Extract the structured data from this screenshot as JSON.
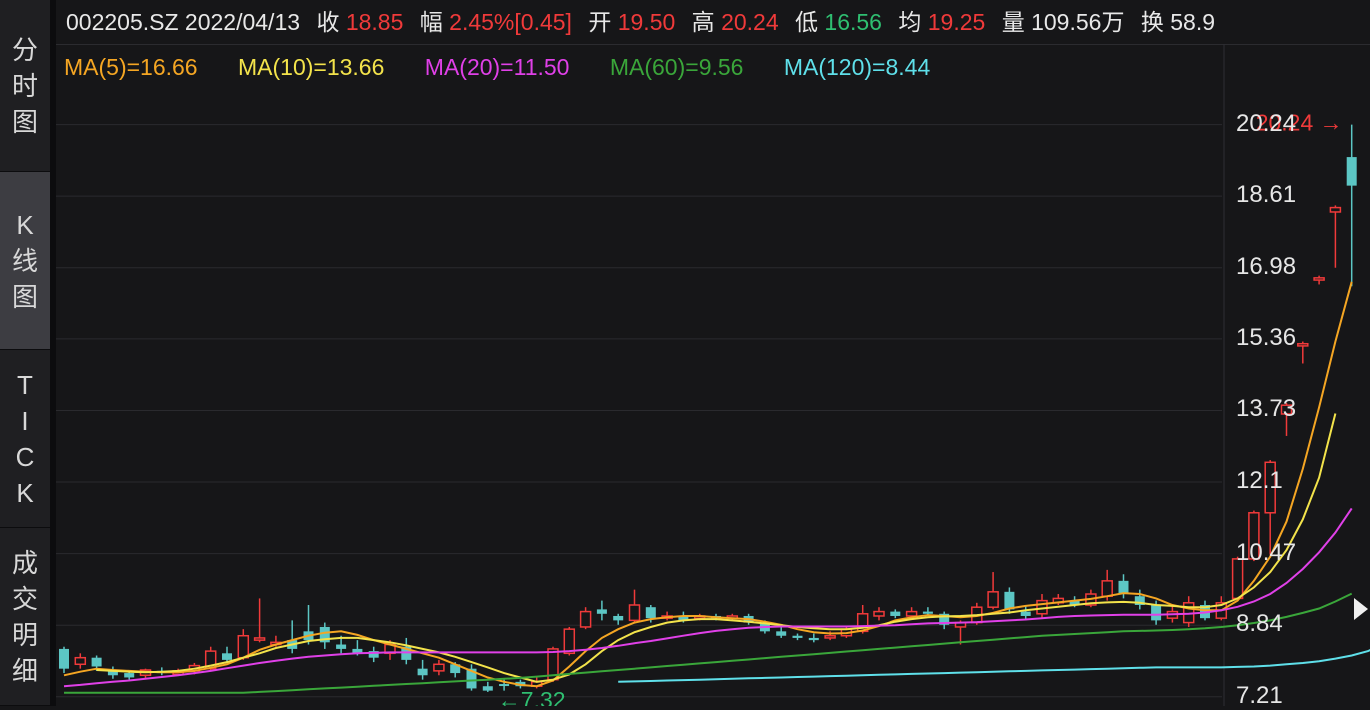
{
  "sidebar": {
    "tabs": [
      {
        "label": "分时图",
        "chars": [
          "分",
          "时",
          "图"
        ],
        "active": false
      },
      {
        "label": "K线图",
        "chars": [
          "K",
          "线",
          "图"
        ],
        "active": true
      },
      {
        "label": "TICK",
        "chars": [
          "T",
          "I",
          "C",
          "K"
        ],
        "active": false
      },
      {
        "label": "成交明细",
        "chars": [
          "成",
          "交",
          "明",
          "细"
        ],
        "active": false
      }
    ]
  },
  "header": {
    "code_date": "002205.SZ 2022/04/13",
    "close_label": "收",
    "close_value": "18.85",
    "change_label": "幅",
    "change_value": "2.45%[0.45]",
    "open_label": "开",
    "open_value": "19.50",
    "high_label": "高",
    "high_value": "20.24",
    "low_label": "低",
    "low_value": "16.56",
    "avg_label": "均",
    "avg_value": "19.25",
    "volume_label": "量",
    "volume_value": "109.56万",
    "turnover_label": "换",
    "turnover_value": "58.9"
  },
  "ma_legend": [
    {
      "text": "MA(5)=16.66",
      "color": "#f5a623"
    },
    {
      "text": "MA(10)=13.66",
      "color": "#f3e34b"
    },
    {
      "text": "MA(20)=11.50",
      "color": "#e040e8"
    },
    {
      "text": "MA(60)=9.56",
      "color": "#3aa63a"
    },
    {
      "text": "MA(120)=8.44",
      "color": "#5fe0ea"
    }
  ],
  "chart_data": {
    "type": "candlestick",
    "ylim": [
      7.0,
      20.8
    ],
    "yticks": [
      "20.24",
      "18.61",
      "16.98",
      "15.36",
      "13.73",
      "12.1",
      "10.47",
      "8.84",
      "7.21"
    ],
    "up_color": "#f03a3a",
    "down_color": "#5cc6c4",
    "max_annotation": {
      "text": "20.24",
      "value": 20.24,
      "arrow": "→"
    },
    "min_annotation": {
      "text": "7.32",
      "value": 7.32,
      "arrow": "←"
    },
    "candles": [
      [
        8.3,
        7.85,
        8.35,
        7.75
      ],
      [
        7.95,
        8.1,
        8.2,
        7.85
      ],
      [
        8.1,
        7.9,
        8.15,
        7.8
      ],
      [
        7.8,
        7.7,
        7.9,
        7.62
      ],
      [
        7.75,
        7.65,
        7.8,
        7.6
      ],
      [
        7.7,
        7.82,
        7.85,
        7.62
      ],
      [
        7.8,
        7.75,
        7.88,
        7.7
      ],
      [
        7.72,
        7.8,
        7.85,
        7.7
      ],
      [
        7.8,
        7.92,
        7.98,
        7.72
      ],
      [
        7.85,
        8.25,
        8.35,
        7.8
      ],
      [
        8.2,
        8.05,
        8.35,
        8.0
      ],
      [
        8.1,
        8.6,
        8.75,
        8.05
      ],
      [
        8.5,
        8.55,
        9.45,
        8.45
      ],
      [
        8.4,
        8.45,
        8.6,
        8.35
      ],
      [
        8.5,
        8.3,
        8.95,
        8.2
      ],
      [
        8.7,
        8.5,
        9.3,
        8.4
      ],
      [
        8.8,
        8.45,
        8.9,
        8.3
      ],
      [
        8.4,
        8.3,
        8.6,
        8.2
      ],
      [
        8.3,
        8.2,
        8.5,
        8.15
      ],
      [
        8.25,
        8.1,
        8.35,
        8.0
      ],
      [
        8.2,
        8.4,
        8.5,
        8.05
      ],
      [
        8.35,
        8.05,
        8.55,
        7.95
      ],
      [
        7.85,
        7.7,
        8.05,
        7.6
      ],
      [
        7.8,
        7.95,
        8.05,
        7.7
      ],
      [
        7.95,
        7.75,
        8.0,
        7.65
      ],
      [
        7.85,
        7.4,
        7.95,
        7.35
      ],
      [
        7.45,
        7.35,
        7.55,
        7.32
      ],
      [
        7.5,
        7.48,
        7.6,
        7.35
      ],
      [
        7.55,
        7.45,
        7.6,
        7.4
      ],
      [
        7.45,
        7.55,
        7.65,
        7.4
      ],
      [
        7.6,
        8.3,
        8.35,
        7.55
      ],
      [
        8.2,
        8.75,
        8.8,
        8.15
      ],
      [
        8.8,
        9.15,
        9.25,
        8.75
      ],
      [
        9.2,
        9.1,
        9.4,
        8.95
      ],
      [
        9.05,
        8.95,
        9.1,
        8.85
      ],
      [
        8.95,
        9.3,
        9.65,
        8.9
      ],
      [
        9.25,
        9.0,
        9.3,
        8.9
      ],
      [
        9.0,
        9.05,
        9.15,
        8.95
      ],
      [
        9.05,
        8.95,
        9.15,
        8.9
      ],
      [
        9.0,
        9.05,
        9.1,
        8.95
      ],
      [
        9.05,
        9.0,
        9.1,
        8.95
      ],
      [
        9.0,
        9.05,
        9.1,
        8.95
      ],
      [
        9.05,
        8.9,
        9.1,
        8.85
      ],
      [
        8.9,
        8.7,
        8.95,
        8.65
      ],
      [
        8.7,
        8.6,
        8.8,
        8.55
      ],
      [
        8.6,
        8.55,
        8.65,
        8.5
      ],
      [
        8.55,
        8.5,
        8.65,
        8.45
      ],
      [
        8.55,
        8.6,
        8.7,
        8.5
      ],
      [
        8.6,
        8.75,
        8.8,
        8.55
      ],
      [
        8.7,
        9.1,
        9.3,
        8.65
      ],
      [
        9.05,
        9.15,
        9.25,
        8.95
      ],
      [
        9.15,
        9.05,
        9.2,
        9.0
      ],
      [
        9.05,
        9.15,
        9.25,
        9.0
      ],
      [
        9.15,
        9.1,
        9.25,
        9.05
      ],
      [
        9.1,
        8.85,
        9.15,
        8.75
      ],
      [
        8.8,
        8.9,
        8.95,
        8.4
      ],
      [
        8.9,
        9.25,
        9.35,
        8.85
      ],
      [
        9.25,
        9.6,
        10.05,
        9.2
      ],
      [
        9.6,
        9.2,
        9.7,
        9.1
      ],
      [
        9.15,
        9.05,
        9.3,
        8.95
      ],
      [
        9.1,
        9.4,
        9.55,
        9.0
      ],
      [
        9.35,
        9.45,
        9.55,
        9.3
      ],
      [
        9.4,
        9.3,
        9.5,
        9.25
      ],
      [
        9.3,
        9.55,
        9.65,
        9.25
      ],
      [
        9.5,
        9.85,
        10.1,
        9.4
      ],
      [
        9.85,
        9.55,
        10.0,
        9.45
      ],
      [
        9.5,
        9.3,
        9.65,
        9.2
      ],
      [
        9.3,
        8.95,
        9.4,
        8.85
      ],
      [
        9.0,
        9.15,
        9.3,
        8.9
      ],
      [
        8.9,
        9.35,
        9.5,
        8.8
      ],
      [
        9.3,
        9.0,
        9.4,
        8.95
      ],
      [
        9.0,
        9.35,
        9.5,
        8.95
      ],
      [
        9.45,
        10.35,
        10.4,
        10.1
      ],
      [
        10.35,
        11.4,
        11.45,
        10.3
      ],
      [
        11.4,
        12.55,
        12.6,
        10.45
      ],
      [
        13.65,
        13.85,
        13.9,
        13.15
      ],
      [
        15.2,
        15.25,
        15.3,
        14.8
      ],
      [
        16.7,
        16.75,
        16.8,
        16.6
      ],
      [
        18.25,
        18.35,
        18.4,
        16.98
      ],
      [
        19.5,
        18.85,
        20.24,
        16.56
      ]
    ],
    "ma_series": [
      {
        "name": "MA(5)",
        "color": "#f5a623",
        "start": 0,
        "values": [
          7.7,
          7.78,
          7.85,
          7.82,
          7.8,
          7.78,
          7.77,
          7.77,
          7.8,
          7.87,
          7.95,
          8.1,
          8.28,
          8.4,
          8.5,
          8.6,
          8.67,
          8.7,
          8.62,
          8.5,
          8.4,
          8.3,
          8.2,
          8.1,
          7.95,
          7.8,
          7.65,
          7.55,
          7.48,
          7.45,
          7.58,
          7.9,
          8.25,
          8.55,
          8.75,
          8.9,
          8.98,
          9.02,
          9.05,
          9.05,
          9.02,
          9.0,
          8.98,
          8.92,
          8.85,
          8.75,
          8.68,
          8.65,
          8.66,
          8.72,
          8.82,
          8.95,
          9.02,
          9.07,
          9.05,
          9.02,
          9.05,
          9.12,
          9.22,
          9.28,
          9.32,
          9.36,
          9.4,
          9.44,
          9.5,
          9.57,
          9.55,
          9.45,
          9.3,
          9.22,
          9.18,
          9.18,
          9.4,
          9.85,
          10.4,
          11.2,
          12.4,
          13.8,
          15.3,
          16.66
        ]
      },
      {
        "name": "MA(10)",
        "color": "#f3e34b",
        "start": 2,
        "values": [
          7.82,
          7.8,
          7.78,
          7.77,
          7.78,
          7.8,
          7.85,
          7.92,
          8.0,
          8.1,
          8.2,
          8.32,
          8.4,
          8.48,
          8.52,
          8.55,
          8.55,
          8.5,
          8.45,
          8.38,
          8.3,
          8.22,
          8.12,
          8.0,
          7.88,
          7.75,
          7.65,
          7.55,
          7.6,
          7.72,
          7.95,
          8.25,
          8.5,
          8.68,
          8.8,
          8.9,
          8.95,
          8.98,
          8.98,
          8.95,
          8.92,
          8.88,
          8.84,
          8.8,
          8.77,
          8.75,
          8.75,
          8.78,
          8.84,
          8.92,
          8.98,
          9.02,
          9.04,
          9.05,
          9.07,
          9.1,
          9.13,
          9.18,
          9.22,
          9.26,
          9.3,
          9.34,
          9.36,
          9.37,
          9.35,
          9.3,
          9.28,
          9.25,
          9.25,
          9.3,
          9.45,
          9.7,
          10.05,
          10.55,
          11.25,
          12.2,
          13.66
        ]
      },
      {
        "name": "MA(20)",
        "color": "#e040e8",
        "start": 0,
        "values": [
          7.45,
          7.48,
          7.52,
          7.55,
          7.58,
          7.62,
          7.66,
          7.7,
          7.75,
          7.8,
          7.86,
          7.92,
          7.98,
          8.03,
          8.08,
          8.12,
          8.15,
          8.18,
          8.2,
          8.21,
          8.22,
          8.22,
          8.22,
          8.22,
          8.22,
          8.22,
          8.22,
          8.22,
          8.22,
          8.22,
          8.23,
          8.25,
          8.28,
          8.32,
          8.37,
          8.43,
          8.48,
          8.54,
          8.6,
          8.66,
          8.71,
          8.75,
          8.78,
          8.8,
          8.81,
          8.81,
          8.81,
          8.81,
          8.81,
          8.82,
          8.83,
          8.84,
          8.86,
          8.88,
          8.89,
          8.9,
          8.91,
          8.93,
          8.95,
          8.97,
          9.0,
          9.03,
          9.05,
          9.06,
          9.07,
          9.08,
          9.08,
          9.08,
          9.09,
          9.1,
          9.13,
          9.18,
          9.26,
          9.38,
          9.55,
          9.8,
          10.12,
          10.5,
          10.95,
          11.5
        ]
      },
      {
        "name": "MA(60)",
        "color": "#3aa63a",
        "start": 0,
        "values": [
          7.3,
          7.3,
          7.3,
          7.3,
          7.3,
          7.3,
          7.3,
          7.3,
          7.3,
          7.3,
          7.3,
          7.3,
          7.32,
          7.34,
          7.36,
          7.38,
          7.4,
          7.42,
          7.44,
          7.46,
          7.48,
          7.5,
          7.52,
          7.54,
          7.56,
          7.58,
          7.6,
          7.62,
          7.64,
          7.67,
          7.7,
          7.73,
          7.76,
          7.79,
          7.82,
          7.85,
          7.88,
          7.91,
          7.94,
          7.97,
          8.0,
          8.03,
          8.06,
          8.09,
          8.12,
          8.15,
          8.18,
          8.21,
          8.24,
          8.27,
          8.3,
          8.33,
          8.36,
          8.39,
          8.42,
          8.45,
          8.48,
          8.51,
          8.54,
          8.57,
          8.6,
          8.62,
          8.64,
          8.66,
          8.68,
          8.7,
          8.71,
          8.72,
          8.73,
          8.75,
          8.77,
          8.8,
          8.84,
          8.89,
          8.95,
          9.03,
          9.12,
          9.22,
          9.38,
          9.56
        ]
      },
      {
        "name": "MA(120)",
        "color": "#5fe0ea",
        "start": 34,
        "values": [
          7.55,
          7.56,
          7.57,
          7.58,
          7.59,
          7.6,
          7.61,
          7.62,
          7.63,
          7.64,
          7.65,
          7.66,
          7.67,
          7.68,
          7.69,
          7.7,
          7.71,
          7.72,
          7.73,
          7.74,
          7.75,
          7.76,
          7.77,
          7.78,
          7.79,
          7.8,
          7.81,
          7.82,
          7.83,
          7.84,
          7.85,
          7.86,
          7.87,
          7.88,
          7.88,
          7.88,
          7.88,
          7.88,
          7.89,
          7.9,
          7.92,
          7.95,
          7.98,
          8.02,
          8.08,
          8.15,
          8.25,
          8.44
        ]
      }
    ]
  }
}
